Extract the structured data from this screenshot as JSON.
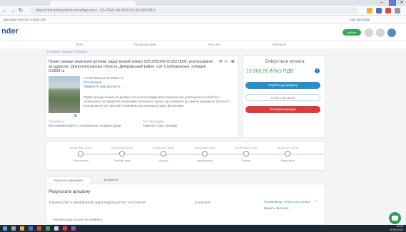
{
  "browser": {
    "url": "https://rmin.inf/auction/rooms/bigs-doc/...SS-7345-UA-2020-02-55-000148-1",
    "bookmarks_label": "Закладки  Внесіть ставки  24k",
    "bookmarks_right": "Інші закладки"
  },
  "site": {
    "logo": "nder",
    "pill_label": "кабінет",
    "subnav": [
      "Лоти",
      "Організаторам",
      "Про нас",
      "Контакти"
    ]
  },
  "breadcrumbs": "Головна  /  Аукціон  /  Аукціон",
  "lot": {
    "title": "Право оренди земельної ділянки, кадастровий номер 1221055000:02:002:0002, розташованої за адресою: Дніпропетровська область, Дніпровський район, смт Слобожанське, площею 0,0203 га",
    "fav_count": "12",
    "id": "UA-PS-2022-12-22-000017-1",
    "status_label": "Оголошення",
    "status_sub": "Прийняття заяв на участь",
    "desc": "Право оренди земельної ділянки сільськогосподарського призначення для ведення особистого селянського господарства за межами населеного пункту, що належить до земель державної власності, розташованої на території Слобожанської селищної ради. Детальніше",
    "more_label": "Детальніше",
    "organizer_label": "Продавець",
    "organizer": "Виконавчий комітет Слобожанської селищної ради",
    "procedure_label": "Тип процедури",
    "procedure": "Земельні торги (оренда)"
  },
  "panel": {
    "title": "Очікується оплата",
    "price": "13 200,00 ₴ без ПДВ",
    "btn_primary": "Перейти до аукціону",
    "btn_secondary": "Стати учасником",
    "btn_danger": "Скасувати аукціон"
  },
  "timeline": {
    "dates": [
      "05.08.2022 12:00",
      "09.08.2022 10:00",
      "24.08.2022 18:00",
      "31.08.2022 10:00",
      "01.09.2022 12:00",
      "31.09.2022 12:00"
    ],
    "labels": [
      "Оголошення",
      "Прийом заяв",
      "Аукціон",
      "Кваліфікація",
      "Оплата",
      "Завершено"
    ]
  },
  "tabs": [
    "Загальна інформація",
    "Документи"
  ],
  "results": {
    "title": "Результати аукціону",
    "row_name": "ТОВАРИСТВО З ОБМЕЖЕНОЮ ВІДПОВІДАЛЬНІСТЮ \"АГРО-МРІЯ\"",
    "row_amount": "13 200,00 ₴",
    "row_status": "Переможець. Очікується оплата",
    "row_status2": "Вкажіть протокол",
    "note": "Рішення щодо оплати не прийнято"
  },
  "taskbar": {
    "time": "12:49",
    "date": "16.09.2022"
  }
}
